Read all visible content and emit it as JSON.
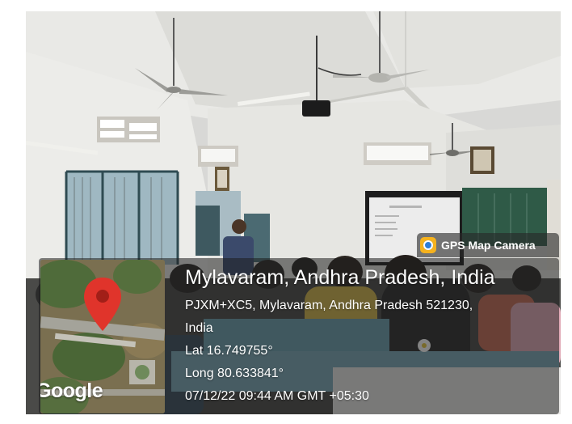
{
  "gps_badge": {
    "label": "GPS Map Camera",
    "icon": "gps-map-camera-app-icon"
  },
  "map": {
    "brand": "Google",
    "pin_icon": "map-pin-icon",
    "pin_color": "#e0342b"
  },
  "location": {
    "title": "Mylavaram, Andhra Pradesh, India",
    "address_line1": "PJXM+XC5, Mylavaram, Andhra Pradesh 521230,",
    "address_line2": "India",
    "latitude": "Lat 16.749755°",
    "longitude": "Long 80.633841°",
    "datetime": "07/12/22 09:44 AM GMT +05:30"
  }
}
